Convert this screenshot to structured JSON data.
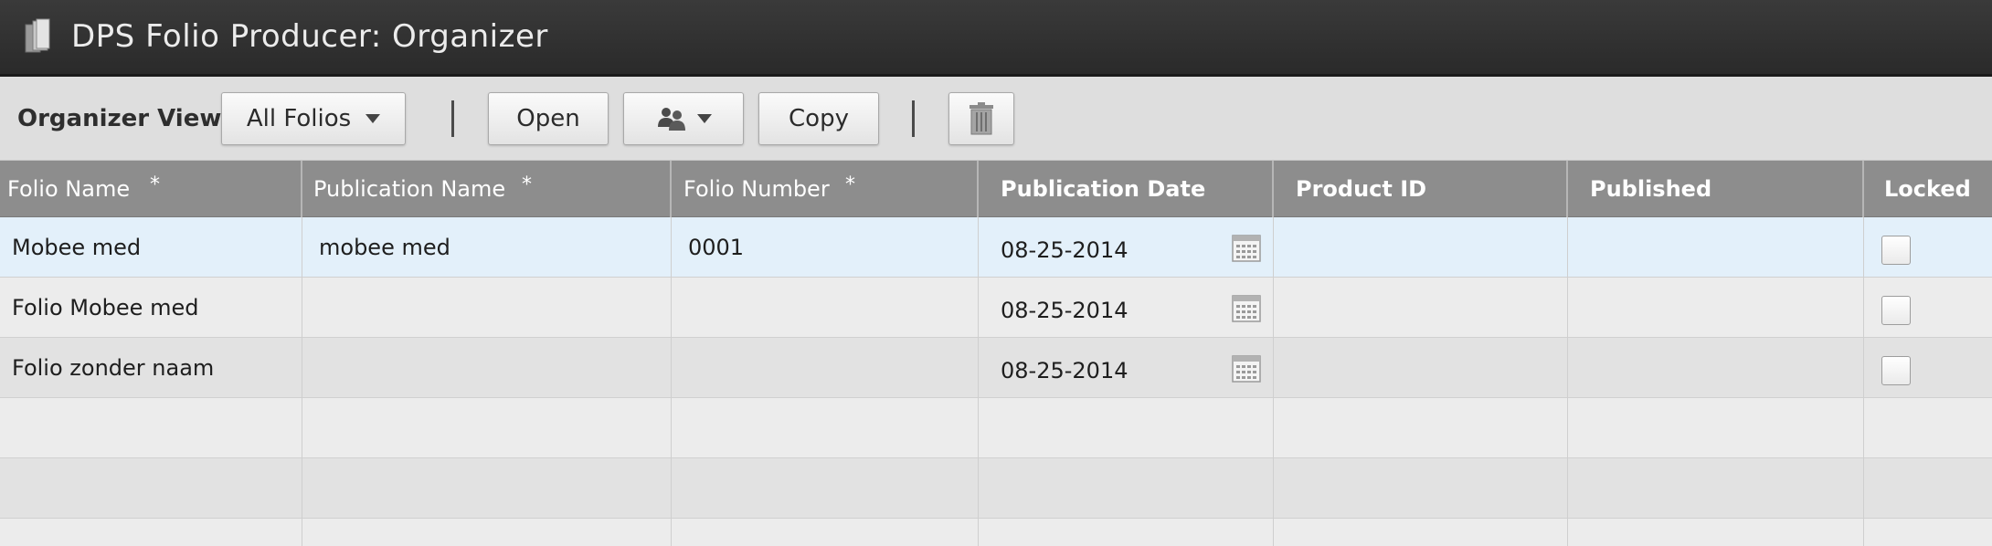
{
  "window": {
    "title": "DPS Folio Producer: Organizer",
    "icon": "folio-book-icon"
  },
  "toolbar": {
    "view_label": "Organizer View:",
    "view_dropdown_value": "All Folios",
    "open_label": "Open",
    "share_icon": "users-icon",
    "copy_label": "Copy",
    "delete_icon": "trash-icon"
  },
  "table": {
    "required_marker": "*",
    "columns": [
      {
        "label": "Folio Name",
        "required": true
      },
      {
        "label": "Publication Name",
        "required": true
      },
      {
        "label": "Folio Number",
        "required": true
      },
      {
        "label": "Publication Date",
        "required": false
      },
      {
        "label": "Product ID",
        "required": false
      },
      {
        "label": "Published",
        "required": false
      },
      {
        "label": "Locked",
        "required": false
      }
    ],
    "rows": [
      {
        "folio_name": "Mobee med",
        "publication_name": "mobee med",
        "folio_number": "0001",
        "publication_date": "08-25-2014",
        "product_id": "",
        "published": "",
        "locked": false,
        "selected": true
      },
      {
        "folio_name": "Folio Mobee med",
        "publication_name": "",
        "folio_number": "",
        "publication_date": "08-25-2014",
        "product_id": "",
        "published": "",
        "locked": false,
        "selected": false
      },
      {
        "folio_name": "Folio zonder naam",
        "publication_name": "",
        "folio_number": "",
        "publication_date": "08-25-2014",
        "product_id": "",
        "published": "",
        "locked": false,
        "selected": false
      }
    ]
  },
  "colors": {
    "titlebar_bg": "#2f2f2f",
    "header_bg": "#8d8d8d",
    "selected_row_bg": "#e3f0fa"
  }
}
